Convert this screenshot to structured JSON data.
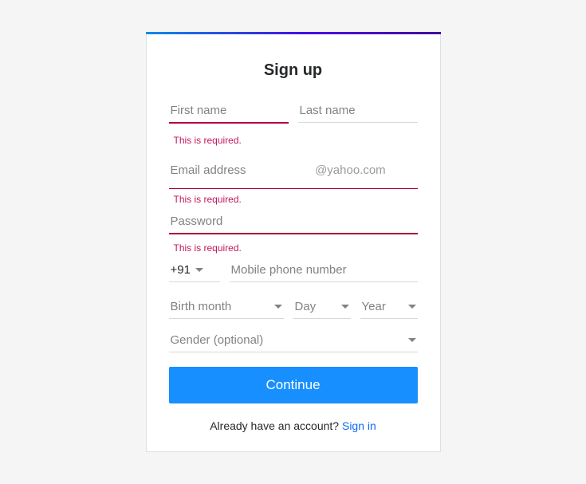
{
  "title": "Sign up",
  "fields": {
    "first_name": {
      "placeholder": "First name",
      "error": "This is required."
    },
    "last_name": {
      "placeholder": "Last name"
    },
    "email": {
      "placeholder": "Email address",
      "suffix": "@yahoo.com",
      "error": "This is required."
    },
    "password": {
      "placeholder": "Password",
      "error": "This is required."
    },
    "country_code": "+91",
    "phone": {
      "placeholder": "Mobile phone number"
    },
    "birth_month": "Birth month",
    "birth_day": "Day",
    "birth_year": "Year",
    "gender": "Gender (optional)"
  },
  "continue_label": "Continue",
  "footer_text": "Already have an account? ",
  "signin_label": "Sign in"
}
